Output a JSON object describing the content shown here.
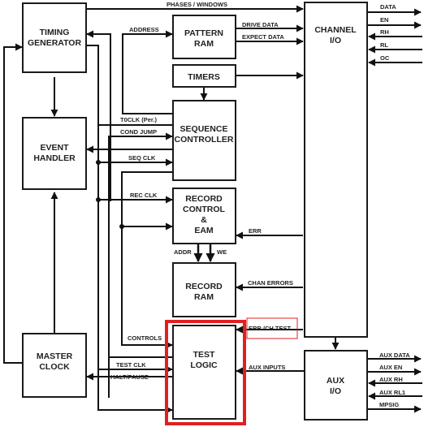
{
  "blocks": {
    "timing_generator": [
      "TIMING",
      "GENERATOR"
    ],
    "event_handler": [
      "EVENT",
      "HANDLER"
    ],
    "master_clock": [
      "MASTER",
      "CLOCK"
    ],
    "pattern_ram": [
      "PATTERN",
      "RAM"
    ],
    "timers": [
      "TIMERS"
    ],
    "sequence_controller": [
      "SEQUENCE",
      "CONTROLLER"
    ],
    "record_control": [
      "RECORD",
      "CONTROL",
      "&",
      "EAM"
    ],
    "record_ram": [
      "RECORD",
      "RAM"
    ],
    "test_logic": [
      "TEST",
      "LOGIC"
    ],
    "channel_io": [
      "CHANNEL",
      "I/O"
    ],
    "aux_io": [
      "AUX",
      "I/O"
    ]
  },
  "signals": {
    "phases_windows": "PHASES / WINDOWS",
    "address": "ADDRESS",
    "drive_data": "DRIVE DATA",
    "expect_data": "EXPECT DATA",
    "t0clk": "T0CLK (Per.)",
    "cond_jump": "COND JUMP",
    "seq_clk": "SEQ CLK",
    "rec_clk": "REC CLK",
    "err": "ERR",
    "addr": "ADDR",
    "we": "WE",
    "chan_errors": "CHAN ERRORS",
    "err_ch_test": "ERR /CH TEST",
    "controls": "CONTROLS",
    "test_clk": "TEST CLK",
    "halt_pause": "HALT/PAUSE",
    "aux_inputs": "AUX INPUTS"
  },
  "channel_outputs": [
    "DATA",
    "EN",
    "RH",
    "RL",
    "OC"
  ],
  "aux_outputs": [
    "AUX DATA",
    "AUX EN",
    "AUX RH",
    "AUX RL1",
    "MPSIG"
  ],
  "highlight_color": "#e02020"
}
